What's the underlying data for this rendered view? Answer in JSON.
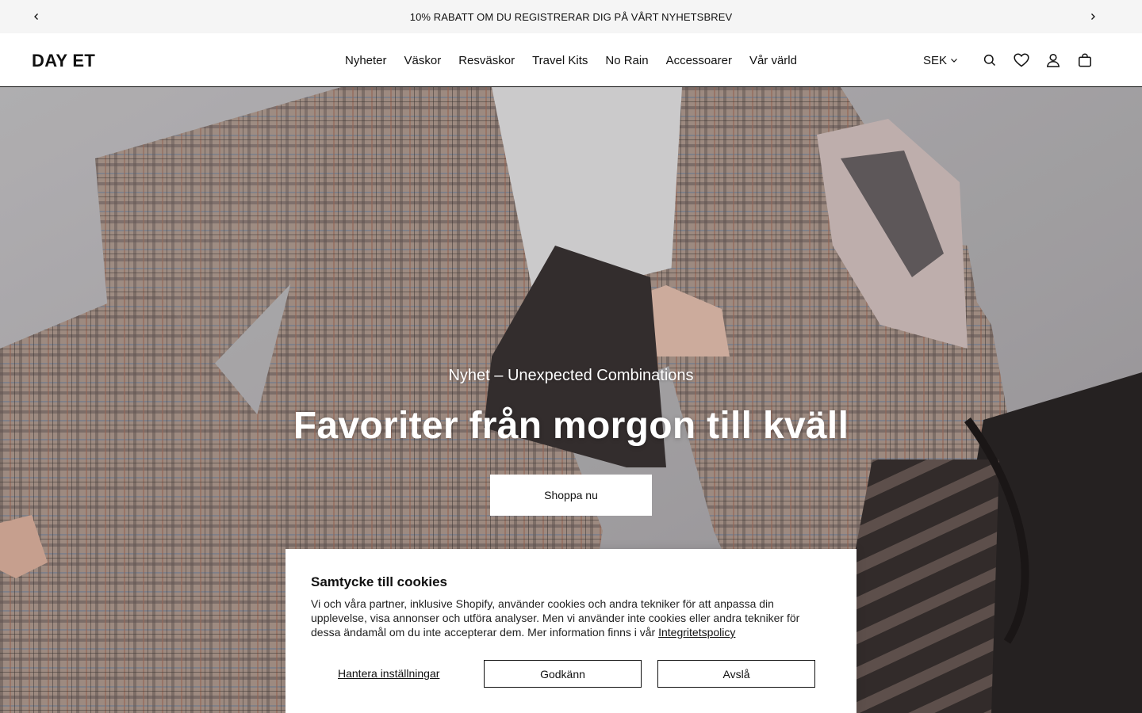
{
  "announcement": {
    "text": "10% RABATT OM DU REGISTRERAR DIG PÅ VÅRT NYHETSBREV",
    "prev_icon": "chevron-left-icon",
    "next_icon": "chevron-right-icon"
  },
  "header": {
    "logo": "DAY ET",
    "nav": [
      {
        "label": "Nyheter"
      },
      {
        "label": "Väskor"
      },
      {
        "label": "Resväskor"
      },
      {
        "label": "Travel Kits"
      },
      {
        "label": "No Rain"
      },
      {
        "label": "Accessoarer"
      },
      {
        "label": "Vår värld"
      }
    ],
    "currency": "SEK",
    "icons": [
      "search-icon",
      "heart-icon",
      "user-icon",
      "bag-icon"
    ]
  },
  "hero": {
    "subtitle": "Nyhet – Unexpected Combinations",
    "title": "Favoriter från morgon till kväll",
    "cta": "Shoppa nu"
  },
  "cookie": {
    "title": "Samtycke till cookies",
    "body": "Vi och våra partner, inklusive Shopify, använder cookies och andra tekniker för att anpassa din upplevelse, visa annonser och utföra analyser. Men vi använder inte cookies eller andra tekniker för dessa ändamål om du inte accepterar dem. Mer information finns i vår ",
    "policy_link": "Integritetspolicy",
    "manage": "Hantera inställningar",
    "accept": "Godkänn",
    "decline": "Avslå"
  },
  "colors": {
    "announcement_bg": "#f5f5f5",
    "text": "#111111",
    "button_bg": "#ffffff"
  }
}
